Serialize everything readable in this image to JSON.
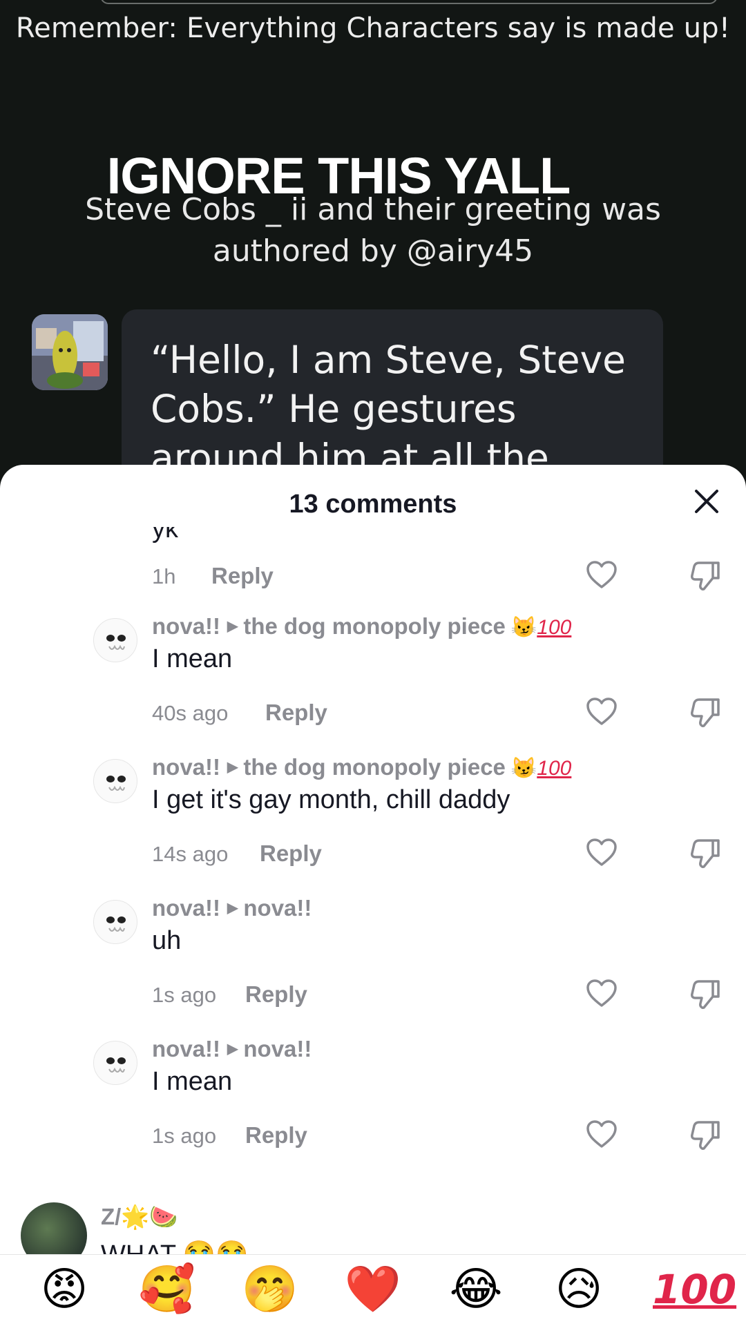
{
  "video": {
    "disclaimer": "Remember: Everything Characters say is made up!",
    "overlay_title": "IGNORE THIS YALL",
    "greeting_line1": "Steve Cobs _ ii and their greeting was",
    "greeting_line2": "authored by @airy45",
    "bubble_text": "“Hello, I am Steve, Steve Cobs.” He gestures around him at all the technology"
  },
  "sheet": {
    "title": "13 comments",
    "close_icon": "close-icon"
  },
  "comments": {
    "partial_top": {
      "text": "yk",
      "time": "1h",
      "reply": "Reply"
    },
    "items": [
      {
        "user": "nova!!",
        "reply_to": "the dog monopoly piece",
        "reply_to_emojis": "😼",
        "reply_to_badge": "100",
        "body": "I mean",
        "time": "40s ago",
        "reply": "Reply"
      },
      {
        "user": "nova!!",
        "reply_to": "the dog monopoly piece",
        "reply_to_emojis": "😼",
        "reply_to_badge": "100",
        "body": "I get it's gay month, chill daddy",
        "time": "14s ago",
        "reply": "Reply"
      },
      {
        "user": "nova!!",
        "reply_to": "nova!!",
        "body": "uh",
        "time": "1s ago",
        "reply": "Reply"
      },
      {
        "user": "nova!!",
        "reply_to": "nova!!",
        "body": "I mean",
        "time": "1s ago",
        "reply": "Reply"
      }
    ],
    "partial_bottom": {
      "user": "Z/🌟🍉",
      "body": "WHAT 😭😭"
    }
  },
  "emoji_bar": [
    "😡",
    "🥰",
    "🤭",
    "❤️",
    "😂",
    "😥",
    "100"
  ],
  "colors": {
    "accent_red": "#e0254a",
    "muted": "#8a8b91",
    "text": "#161823",
    "video_bg": "#121614"
  }
}
